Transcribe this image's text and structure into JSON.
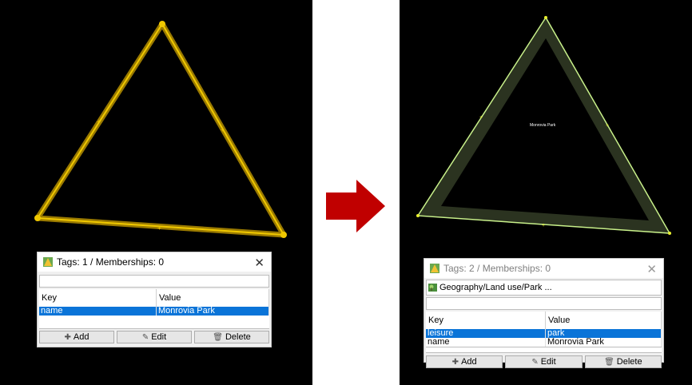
{
  "before": {
    "panel": {
      "title": "Tags: 1 / Memberships: 0",
      "columns": [
        "Key",
        "Value"
      ],
      "rows": [
        {
          "key": "name",
          "value": "Monrovia Park",
          "selected": true
        }
      ],
      "buttons": {
        "add": "Add",
        "edit": "Edit",
        "delete": "Delete"
      }
    }
  },
  "after": {
    "map_label": "Monrovia Park",
    "panel": {
      "title": "Tags: 2 / Memberships: 0",
      "preset": "Geography/Land use/Park ...",
      "columns": [
        "Key",
        "Value"
      ],
      "rows": [
        {
          "key": "leisure",
          "value": "park",
          "selected": true
        },
        {
          "key": "name",
          "value": "Monrovia Park",
          "selected": false
        }
      ],
      "buttons": {
        "add": "Add",
        "edit": "Edit",
        "delete": "Delete"
      }
    }
  },
  "colors": {
    "selection_yellow": "#e0c000",
    "park_outline": "#c8f08a",
    "park_fill": "#2b3320",
    "arrow_red": "#c00000",
    "row_selected": "#0a74d8"
  }
}
